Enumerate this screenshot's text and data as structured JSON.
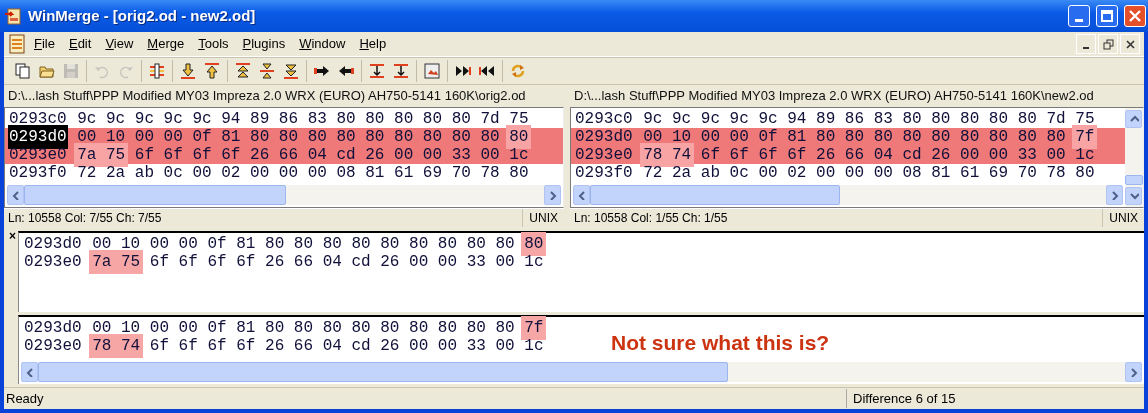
{
  "window": {
    "title": "WinMerge - [orig2.od - new2.od]"
  },
  "menu": [
    "File",
    "Edit",
    "View",
    "Merge",
    "Tools",
    "Plugins",
    "Window",
    "Help"
  ],
  "toolbar": [
    [
      {
        "kind": "new",
        "disabled": false
      },
      {
        "kind": "open",
        "disabled": false
      },
      {
        "kind": "save",
        "disabled": true
      }
    ],
    [
      {
        "kind": "undo",
        "disabled": true
      },
      {
        "kind": "redo",
        "disabled": true
      }
    ],
    [
      {
        "kind": "bars",
        "disabled": false
      }
    ],
    [
      {
        "kind": "down",
        "disabled": false
      },
      {
        "kind": "up",
        "disabled": false
      }
    ],
    [
      {
        "kind": "first",
        "disabled": false
      },
      {
        "kind": "current",
        "disabled": false
      },
      {
        "kind": "last",
        "disabled": false
      }
    ],
    [
      {
        "kind": "right",
        "disabled": false
      },
      {
        "kind": "left",
        "disabled": false
      }
    ],
    [
      {
        "kind": "nextconf",
        "disabled": false
      },
      {
        "kind": "prevconf",
        "disabled": false
      }
    ],
    [
      {
        "kind": "picture",
        "disabled": false
      }
    ],
    [
      {
        "kind": "allright",
        "disabled": false
      },
      {
        "kind": "allleft",
        "disabled": false
      }
    ],
    [
      {
        "kind": "refresh",
        "disabled": false
      }
    ]
  ],
  "left_pane": {
    "path": "D:\\...lash Stuff\\PPP Modified MY03 Impreza 2.0 WRX (EURO) AH750-5141 160K\\orig2.od",
    "rows": [
      {
        "address": "0293c0",
        "cursor": false,
        "diff": false,
        "segments": [
          {
            "text": "9c 9c 9c 9c 9c 94 89 86 83 80 80 80 80 80 7d 75",
            "changed": false
          }
        ]
      },
      {
        "address": "0293d0",
        "cursor": true,
        "diff": true,
        "segments": [
          {
            "text": "00 10 00 00 0f 81 80 80 80 80 80 80 80 80 80",
            "changed": false
          },
          {
            "text": "80",
            "changed": true
          }
        ]
      },
      {
        "address": "0293e0",
        "cursor": false,
        "diff": true,
        "segments": [
          {
            "text": "7a 75",
            "changed": true
          },
          {
            "text": "6f 6f 6f 6f 26 66 04 cd 26 00 00 33 00 1c",
            "changed": false
          }
        ]
      },
      {
        "address": "0293f0",
        "cursor": false,
        "diff": false,
        "segments": [
          {
            "text": "72 2a ab 0c 00 02 00 00 00 08 81 61 69 70 78 80",
            "changed": false
          }
        ]
      }
    ],
    "status": {
      "position": "Ln: 10558  Col: 7/55  Ch: 7/55",
      "eol": "UNIX"
    }
  },
  "right_pane": {
    "path": "D:\\...lash Stuff\\PPP Modified MY03 Impreza 2.0 WRX (EURO) AH750-5141 160K\\new2.od",
    "rows": [
      {
        "address": "0293c0",
        "cursor": false,
        "diff": false,
        "segments": [
          {
            "text": "9c 9c 9c 9c 9c 94 89 86 83 80 80 80 80 80 7d 75",
            "changed": false
          }
        ]
      },
      {
        "address": "0293d0",
        "cursor": false,
        "diff": true,
        "segments": [
          {
            "text": "00 10 00 00 0f 81 80 80 80 80 80 80 80 80 80",
            "changed": false
          },
          {
            "text": "7f",
            "changed": true
          }
        ]
      },
      {
        "address": "0293e0",
        "cursor": false,
        "diff": true,
        "segments": [
          {
            "text": "78 74",
            "changed": true
          },
          {
            "text": "6f 6f 6f 6f 26 66 04 cd 26 00 00 33 00 1c",
            "changed": false
          }
        ]
      },
      {
        "address": "0293f0",
        "cursor": false,
        "diff": false,
        "segments": [
          {
            "text": "72 2a ab 0c 00 02 00 00 00 08 81 61 69 70 78 80",
            "changed": false
          }
        ]
      }
    ],
    "status": {
      "position": "Ln: 10558  Col: 1/55  Ch: 1/55",
      "eol": "UNIX"
    }
  },
  "detail": {
    "close": "×",
    "top": [
      {
        "address": "0293d0",
        "segments": [
          {
            "text": "00 10 00 00 0f 81 80 80 80 80 80 80 80 80 80",
            "changed": false
          },
          {
            "text": "80",
            "changed": true
          }
        ]
      },
      {
        "address": "0293e0",
        "segments": [
          {
            "text": "7a 75",
            "changed": true
          },
          {
            "text": "6f 6f 6f 6f 26 66 04 cd 26 00 00 33 00 1c",
            "changed": false
          }
        ]
      }
    ],
    "bottom": [
      {
        "address": "0293d0",
        "segments": [
          {
            "text": "00 10 00 00 0f 81 80 80 80 80 80 80 80 80 80",
            "changed": false
          },
          {
            "text": "7f",
            "changed": true
          }
        ]
      },
      {
        "address": "0293e0",
        "segments": [
          {
            "text": "78 74",
            "changed": true
          },
          {
            "text": "6f 6f 6f 6f 26 66 04 cd 26 00 00 33 00 1c",
            "changed": false
          }
        ]
      }
    ],
    "annotation": "Not sure what this is?"
  },
  "status_bar": {
    "message": "Ready",
    "difference": "Difference 6 of 15"
  }
}
